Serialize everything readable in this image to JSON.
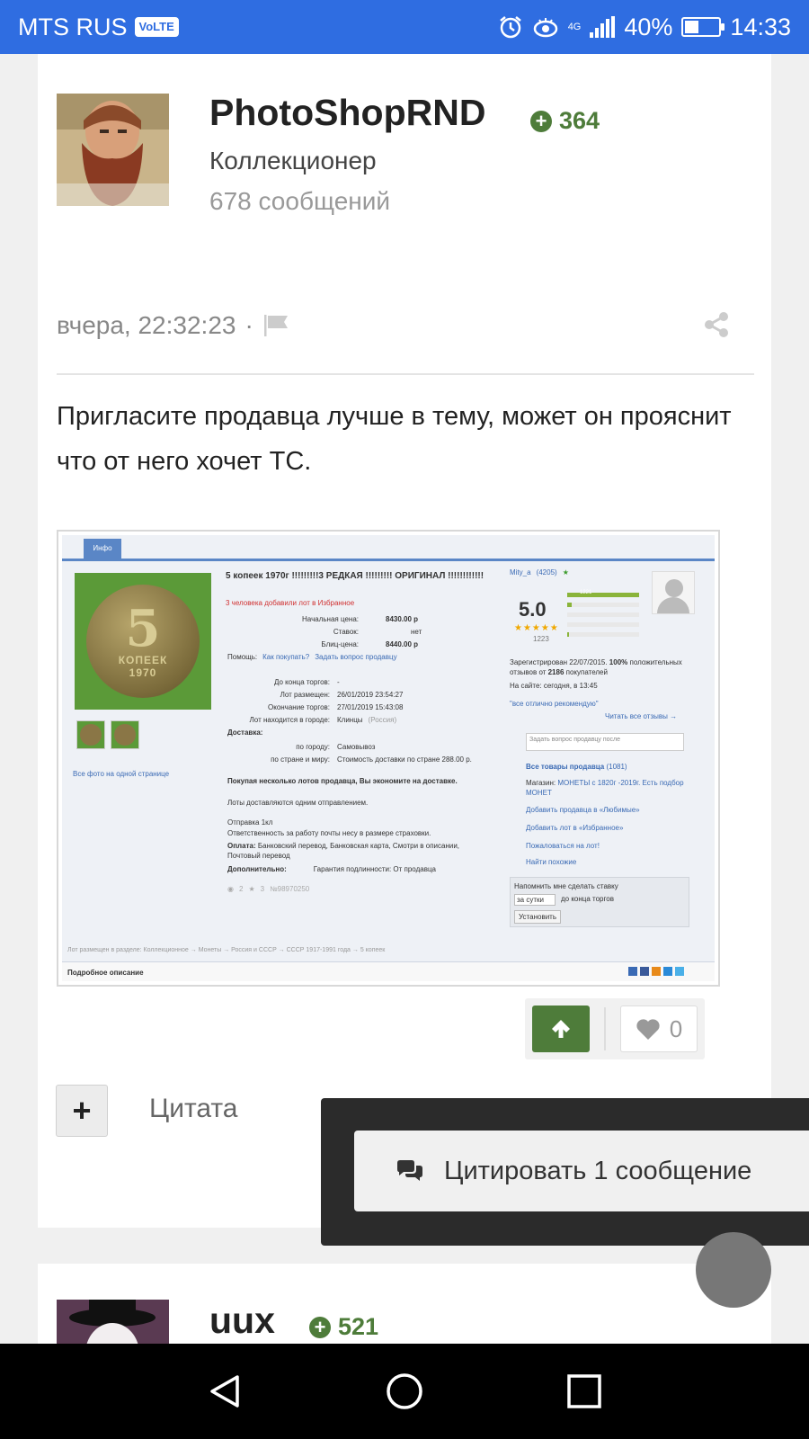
{
  "status_bar": {
    "carrier": "MTS RUS",
    "volte": "VoLTE",
    "network": "4G",
    "battery": "40%",
    "battery_level": 0.4,
    "time": "14:33"
  },
  "post": {
    "author": "PhotoShopRND",
    "reputation": "364",
    "user_title": "Коллекционер",
    "post_count": "678 сообщений",
    "timestamp": "вчера, 22:32:23",
    "separator": "·",
    "text": "Пригласите продавца лучше в тему, может он прояснит что от него хочет ТС.",
    "likes": "0",
    "quote_label": "Цитата"
  },
  "embedded_screenshot": {
    "tab": "Инфо",
    "title": "5 копеек 1970г !!!!!!!!!3 РЕДКАЯ !!!!!!!!! ОРИГИНАЛ !!!!!!!!!!!!",
    "favorites_note": "3 человека добавили лот в Избранное",
    "start_price_label": "Начальная цена:",
    "start_price": "8430.00 р",
    "bids_label": "Ставок:",
    "bids": "нет",
    "blitz_label": "Блиц-цена:",
    "blitz": "8440.00 р",
    "help_label": "Помощь:",
    "help_link1": "Как покупать?",
    "help_link2": "Задать вопрос продавцу",
    "ends_label": "До конца торгов:",
    "ends": "-",
    "placed_label": "Лот размещен:",
    "placed": "26/01/2019 23:54:27",
    "end_label": "Окончание торгов:",
    "end": "27/01/2019 15:43:08",
    "city_label": "Лот находится в городе:",
    "city": "Клинцы",
    "country": "(Россия)",
    "delivery_label": "Доставка:",
    "city_delivery_label": "по городу:",
    "city_delivery": "Самовывоз",
    "world_delivery_label": "по стране и миру:",
    "world_delivery": "Стоимость доставки по стране 288.00 р.",
    "multi_lot": "Покупая несколько лотов продавца, Вы экономите на доставке.",
    "multi_lot2": "Лоты доставляются одним отправлением.",
    "shipping": "Отправка 1кл",
    "responsibility": "Ответственность за работу почты несу в размере страховки.",
    "payment_label": "Оплата:",
    "payment": "Банковский перевод, Банковская карта, Смотри в описании, Почтовый перевод",
    "extra_label": "Дополнительно:",
    "extra": "Гарантия подлинности: От продавца",
    "lot_id": "№98970250",
    "lot_views": "2",
    "lot_stars": "3",
    "all_photos": "Все фото на одной странице",
    "coin_value": "5",
    "coin_word": "КОПЕЕК",
    "coin_year": "1970",
    "seller": "Mity_a",
    "seller_score": "(4205)",
    "rating": "5.0",
    "rating_count": "1223",
    "bar_labels": [
      "5",
      "4",
      "3",
      "2",
      "1"
    ],
    "bar_fills": [
      1.0,
      0.06,
      0.0,
      0.0,
      0.02
    ],
    "top_bar_value": "1221",
    "registered": "Зарегистрирован 22/07/2015.",
    "registered_pct": "100%",
    "reviews_note": "положительных отзывов от",
    "reviews_count": "2186",
    "buyers": "покупателей",
    "online": "На сайте: сегодня, в 13:45",
    "quote": "\"все отлично рекомендую\"",
    "all_reviews": "Читать все отзывы →",
    "ask_placeholder": "Задать вопрос продавцу после",
    "all_lots": "Все товары продавца",
    "all_lots_count": "(1081)",
    "shop_label": "Магазин:",
    "shop": "МОНЕТЫ с 1820г -2019г. Есть подбор МОНЕТ",
    "add_fav_seller": "Добавить продавца в «Любимые»",
    "add_fav_lot": "Добавить лот в «Избранное»",
    "complain": "Пожаловаться на лот!",
    "find_similar": "Найти похожие",
    "remind": "Напомнить мне сделать ставку",
    "remind_select": "за сутки",
    "remind_suffix": "до конца торгов",
    "remind_button": "Установить",
    "breadcrumb": "Лот размещен в разделе: Коллекционное → Монеты → Россия и СССР → СССР 1917-1991 года → 5 копеек",
    "details": "Подробное описание"
  },
  "multiquote": {
    "button": "Цитировать 1 сообщение"
  },
  "post2": {
    "author": "uux",
    "reputation": "521"
  },
  "colors": {
    "status_bar": "#2f6de1",
    "positive": "#4e7c3a"
  }
}
